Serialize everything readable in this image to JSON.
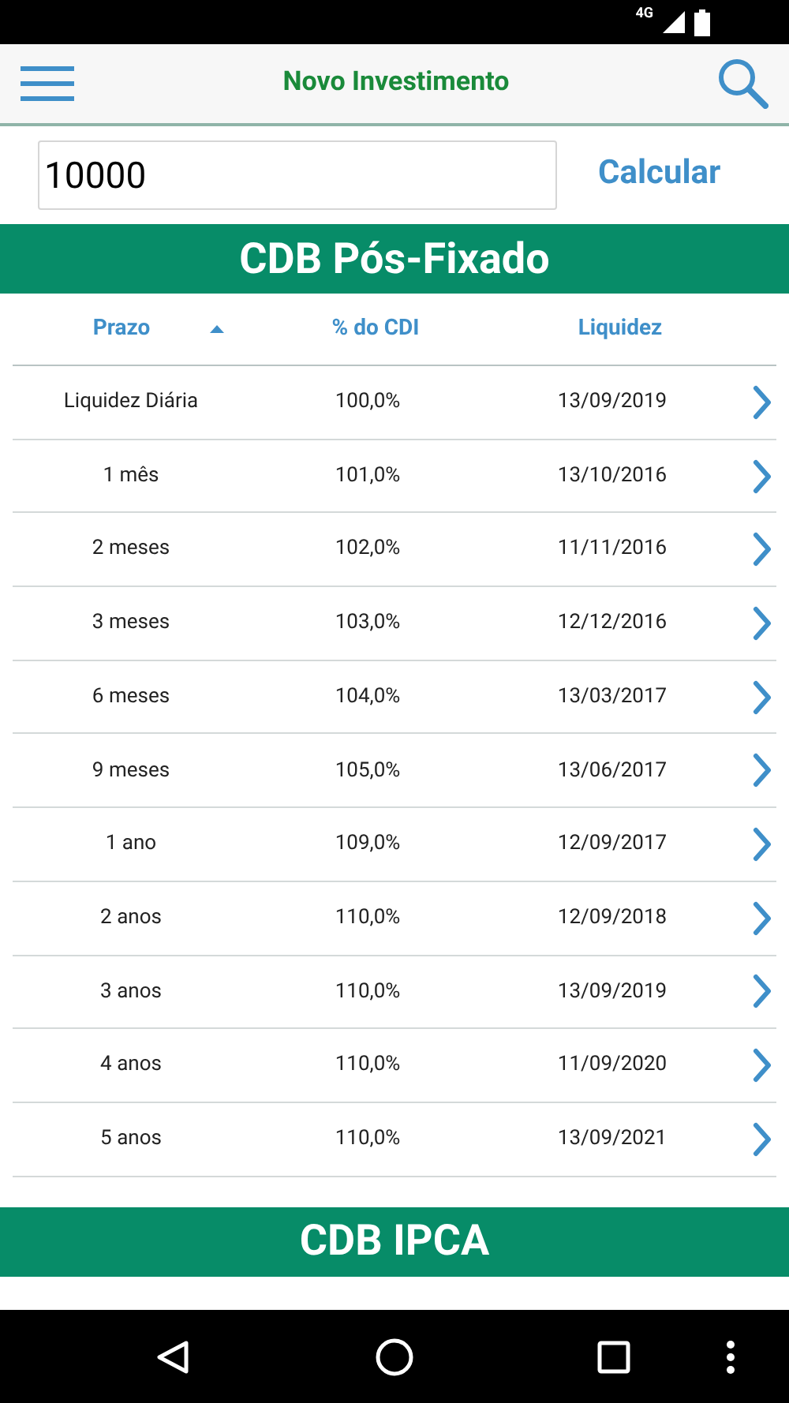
{
  "status_bar": {
    "network": "4G"
  },
  "app_bar": {
    "title": "Novo Investimento"
  },
  "amount_field": {
    "value": "10000"
  },
  "calculate_button": "Calcular",
  "sections": [
    {
      "title": "CDB Pós-Fixado",
      "columns": [
        {
          "label": "Prazo",
          "sorted": true
        },
        {
          "label": "% do CDI",
          "sorted": false
        },
        {
          "label": "Liquidez",
          "sorted": false
        }
      ],
      "rows": [
        [
          "Liquidez Diária",
          "100,0%",
          "13/09/2019"
        ],
        [
          "1 mês",
          "101,0%",
          "13/10/2016"
        ],
        [
          "2 meses",
          "102,0%",
          "11/11/2016"
        ],
        [
          "3 meses",
          "103,0%",
          "12/12/2016"
        ],
        [
          "6 meses",
          "104,0%",
          "13/03/2017"
        ],
        [
          "9 meses",
          "105,0%",
          "13/06/2017"
        ],
        [
          "1 ano",
          "109,0%",
          "12/09/2017"
        ],
        [
          "2 anos",
          "110,0%",
          "12/09/2018"
        ],
        [
          "3 anos",
          "110,0%",
          "13/09/2019"
        ],
        [
          "4 anos",
          "110,0%",
          "11/09/2020"
        ],
        [
          "5 anos",
          "110,0%",
          "13/09/2021"
        ]
      ]
    },
    {
      "title": "CDB IPCA"
    }
  ]
}
